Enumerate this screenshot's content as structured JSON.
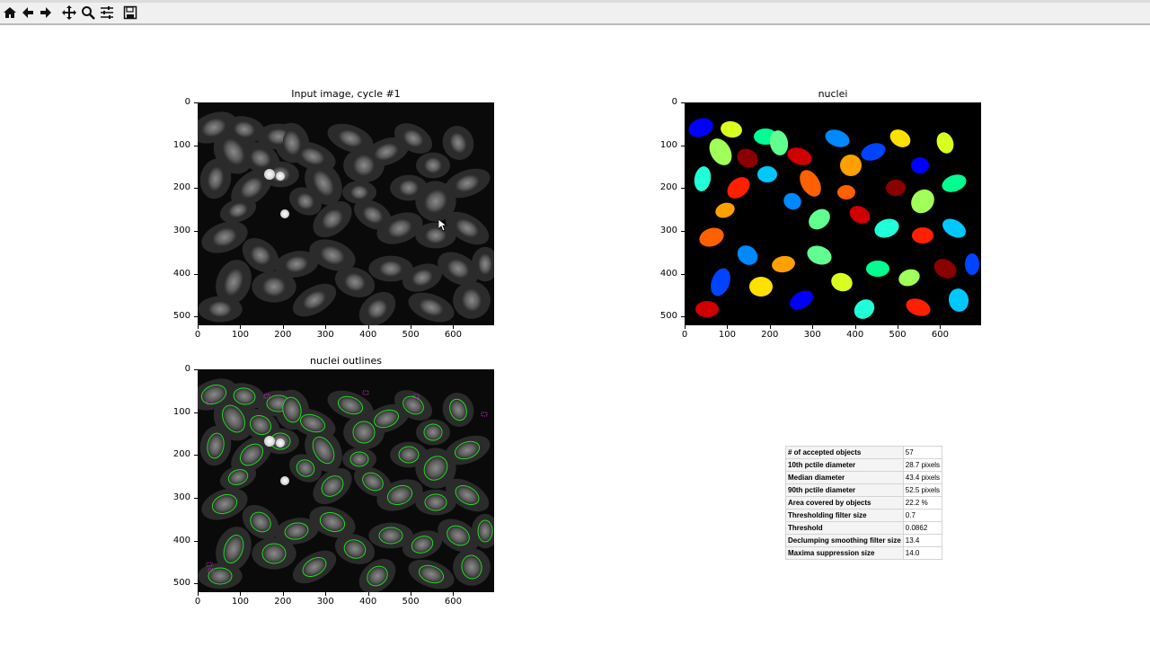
{
  "toolbar": {
    "buttons": [
      {
        "name": "home-icon"
      },
      {
        "name": "back-arrow-icon"
      },
      {
        "name": "forward-arrow-icon"
      },
      {
        "name": "pan-icon"
      },
      {
        "name": "zoom-icon"
      },
      {
        "name": "configure-subplots-icon"
      },
      {
        "name": "save-icon"
      }
    ]
  },
  "panels": {
    "input": {
      "title": "Input image, cycle #1",
      "yticks": [
        "0",
        "100",
        "200",
        "300",
        "400",
        "500"
      ],
      "xticks": [
        "0",
        "100",
        "200",
        "300",
        "400",
        "500",
        "600"
      ]
    },
    "nuclei": {
      "title": "nuclei",
      "yticks": [
        "0",
        "100",
        "200",
        "300",
        "400",
        "500"
      ],
      "xticks": [
        "0",
        "100",
        "200",
        "300",
        "400",
        "500",
        "600"
      ]
    },
    "outlines": {
      "title": "nuclei outlines",
      "yticks": [
        "0",
        "100",
        "200",
        "300",
        "400",
        "500"
      ],
      "xticks": [
        "0",
        "100",
        "200",
        "300",
        "400",
        "500",
        "600"
      ]
    }
  },
  "stats_table": {
    "rows": [
      {
        "label": "# of accepted objects",
        "value": "57"
      },
      {
        "label": "10th pctile diameter",
        "value": "28.7 pixels"
      },
      {
        "label": "Median diameter",
        "value": "43.4 pixels"
      },
      {
        "label": "90th pctile diameter",
        "value": "52.5 pixels"
      },
      {
        "label": "Area covered by objects",
        "value": "22.2 %"
      },
      {
        "label": "Thresholding filter size",
        "value": "0.7"
      },
      {
        "label": "Threshold",
        "value": "0.0862"
      },
      {
        "label": "Declumping smoothing filter size",
        "value": "13.4"
      },
      {
        "label": "Maxima suppression size",
        "value": "14.0"
      }
    ]
  },
  "colors": {
    "outline": "#22dd22",
    "outline_rejected": "#cc22cc",
    "toolbar_bg": "#f0f0f0"
  }
}
